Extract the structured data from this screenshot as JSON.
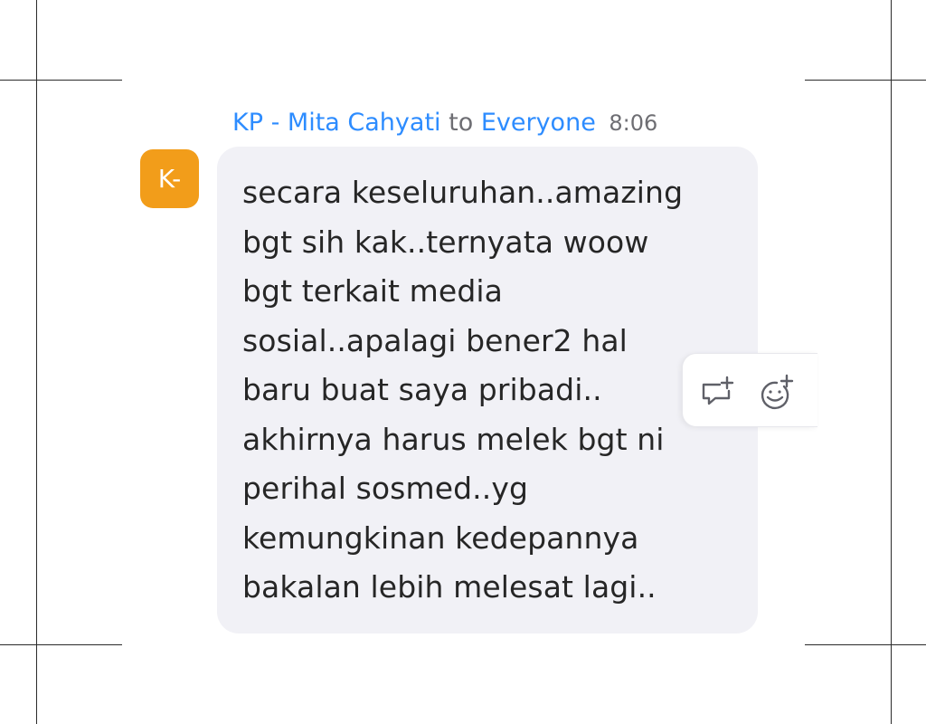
{
  "message": {
    "sender": "KP - Mita Cahyati",
    "to_label": "to",
    "recipient": "Everyone",
    "time": "8:06",
    "avatar_initials": "K-",
    "lines": [
      "secara keseluruhan..amazing",
      "bgt sih kak..ternyata woow",
      "bgt terkait media",
      "sosial..apalagi bener2 hal",
      "baru buat saya pribadi..",
      "akhirnya harus melek bgt ni",
      "perihal sosmed..yg",
      "kemungkinan kedepannya",
      "bakalan lebih melesat lagi.."
    ]
  },
  "actions": {
    "reply_icon": "reply-thread-icon",
    "react_icon": "add-reaction-icon"
  },
  "colors": {
    "link": "#2d8cff",
    "avatar_bg": "#f29d1a",
    "bubble_bg": "#f1f1f6",
    "text": "#262626"
  }
}
